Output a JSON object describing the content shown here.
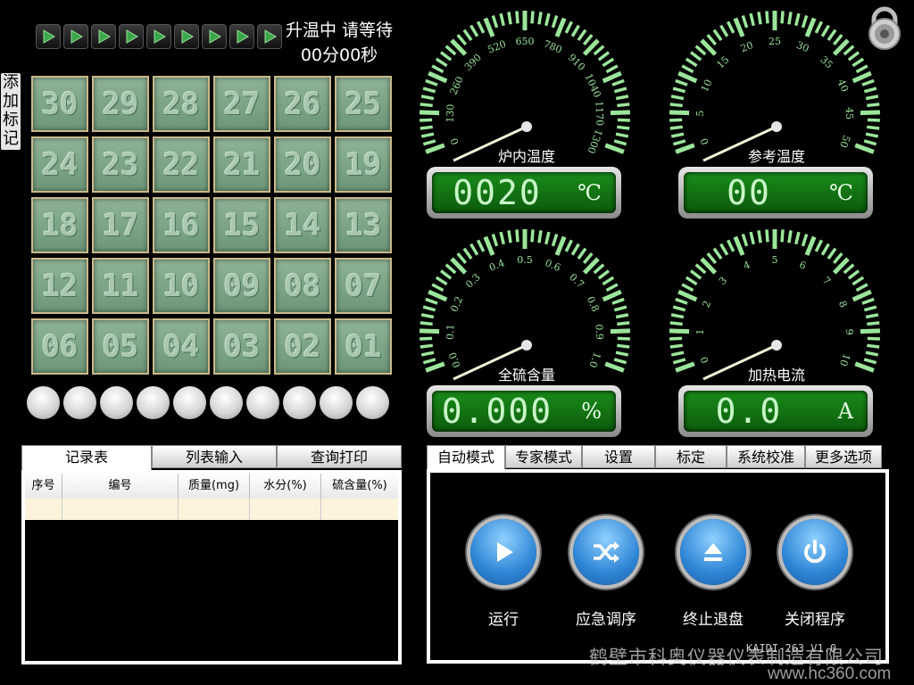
{
  "status": {
    "line1": "升温中  请等待",
    "line2": "00分00秒"
  },
  "add_mark_label": "添\n加\n标\n记",
  "arrows_count": 9,
  "sample_cells": [
    "30",
    "29",
    "28",
    "27",
    "26",
    "25",
    "24",
    "23",
    "22",
    "21",
    "20",
    "19",
    "18",
    "17",
    "16",
    "15",
    "14",
    "13",
    "12",
    "11",
    "10",
    "09",
    "08",
    "07",
    "06",
    "05",
    "04",
    "03",
    "02",
    "01"
  ],
  "balls_count": 10,
  "gauges": [
    {
      "id": "furnace",
      "label": "炉内温度",
      "ticks": [
        "0",
        "130",
        "260",
        "390",
        "520",
        "650",
        "780",
        "910",
        "1040",
        "1170",
        "1300"
      ],
      "value": 20,
      "min": 0,
      "max": 1300,
      "display": "0020",
      "unit": "℃"
    },
    {
      "id": "reference",
      "label": "参考温度",
      "ticks": [
        "0",
        "5",
        "10",
        "15",
        "20",
        "25",
        "30",
        "35",
        "40",
        "45",
        "50"
      ],
      "value": 0,
      "min": 0,
      "max": 50,
      "display": "00",
      "unit": "℃"
    },
    {
      "id": "sulfur",
      "label": "全硫含量",
      "ticks": [
        "0.0",
        "0.1",
        "0.2",
        "0.3",
        "0.4",
        "0.5",
        "0.6",
        "0.7",
        "0.8",
        "0.9",
        "1.0"
      ],
      "value": 0,
      "min": 0,
      "max": 1,
      "display": "0.000",
      "unit": "%"
    },
    {
      "id": "current",
      "label": "加热电流",
      "ticks": [
        "0",
        "1",
        "2",
        "3",
        "4",
        "5",
        "6",
        "7",
        "8",
        "9",
        "10"
      ],
      "value": 0,
      "min": 0,
      "max": 10,
      "display": "0.0",
      "unit": "A"
    }
  ],
  "record_tabs": [
    "记录表",
    "列表输入",
    "查询打印"
  ],
  "record_columns": [
    "序号",
    "编号",
    "质量(mg)",
    "水分(%)",
    "硫含量(%)"
  ],
  "mode_tabs": [
    "自动模式",
    "专家模式",
    "设置",
    "标定",
    "系统校准",
    "更多选项"
  ],
  "controls": [
    {
      "label": "运行",
      "icon": "play-icon"
    },
    {
      "label": "应急调序",
      "icon": "shuffle-icon"
    },
    {
      "label": "终止退盘",
      "icon": "eject-icon"
    },
    {
      "label": "关闭程序",
      "icon": "power-icon"
    }
  ],
  "version": "KAIDI-263  V1.0",
  "watermark": "鹤壁市科奥仪器仪表制造有限公司",
  "watermark_url": "www.hc360.com",
  "colors": {
    "gauge_tick": "#9be59b",
    "lcd_bg": "#137513",
    "cell_bg": "#7fa689",
    "button_blue": "#2f86d6"
  }
}
